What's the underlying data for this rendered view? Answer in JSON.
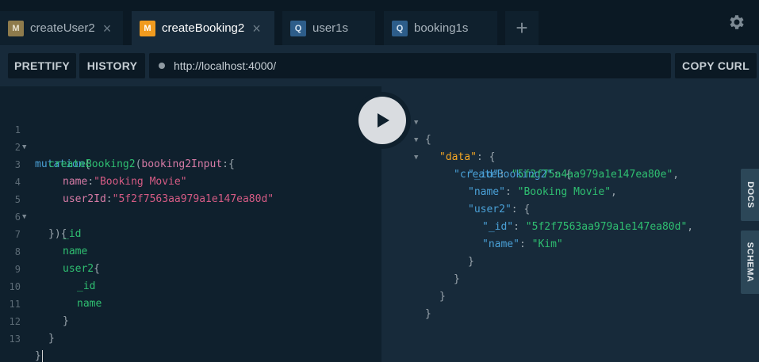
{
  "tabs": [
    {
      "badge": "M",
      "label": "createUser2",
      "close": "×"
    },
    {
      "badge": "M",
      "label": "createBooking2",
      "close": "×"
    },
    {
      "badge": "Q",
      "label": "user1s"
    },
    {
      "badge": "Q",
      "label": "booking1s"
    }
  ],
  "add_tab": "+",
  "toolbar": {
    "prettify": "PRETTIFY",
    "history": "HISTORY",
    "url": "http://localhost:4000/",
    "copy_curl": "COPY CURL"
  },
  "editor": {
    "line_numbers": [
      "1",
      "2",
      "3",
      "4",
      "5",
      "6",
      "7",
      "8",
      "9",
      "10",
      "11",
      "12",
      "13"
    ],
    "lines": {
      "l1_kw": "mutation",
      "l1_p": "{",
      "l2_fn": "createBooking2",
      "l2_p1": "(",
      "l2_arg": "booking2Input",
      "l2_p2": ":{",
      "l3_arg": "name",
      "l3_p": ":",
      "l3_str": "\"Booking Movie\"",
      "l4_arg": "user2Id",
      "l4_p": ":",
      "l4_str": "\"5f2f7563aa979a1e147ea80d\"",
      "l5_p": "}){",
      "l6_fld": "_id",
      "l7_fld": "name",
      "l8_fld": "user2",
      "l8_p": "{",
      "l9_fld": "_id",
      "l10_fld": "name",
      "l11_p": "}",
      "l12_p": "}",
      "l13_p": "}"
    }
  },
  "result": {
    "r1": "{",
    "r2_key": "\"data\"",
    "r2_p": ": {",
    "r3_key": "\"createBooking2\"",
    "r3_p": ": {",
    "r4_key": "\"_id\"",
    "r4_p": ": ",
    "r4_val": "\"5f2f75a4aa979a1e147ea80e\"",
    "r4_c": ",",
    "r5_key": "\"name\"",
    "r5_p": ": ",
    "r5_val": "\"Booking Movie\"",
    "r5_c": ",",
    "r6_key": "\"user2\"",
    "r6_p": ": {",
    "r7_key": "\"_id\"",
    "r7_p": ": ",
    "r7_val": "\"5f2f7563aa979a1e147ea80d\"",
    "r7_c": ",",
    "r8_key": "\"name\"",
    "r8_p": ": ",
    "r8_val": "\"Kim\"",
    "r9": "}",
    "r10": "}",
    "r11": "}",
    "r12": "}"
  },
  "side_tabs": {
    "docs": "DOCS",
    "schema": "SCHEMA"
  },
  "icons": {
    "settings": "gear-icon",
    "run": "play-icon",
    "fold": "caret-down-icon"
  },
  "colors": {
    "mutation_badge_active": "#f19b1f",
    "mutation_badge_inactive": "#8e7b4c",
    "query_badge": "#2d5d8a",
    "keyword": "#4aa0d6",
    "field": "#2fbf71",
    "argument": "#d77ba6",
    "string": "#d55b84",
    "result_top_key": "#f5a623"
  }
}
